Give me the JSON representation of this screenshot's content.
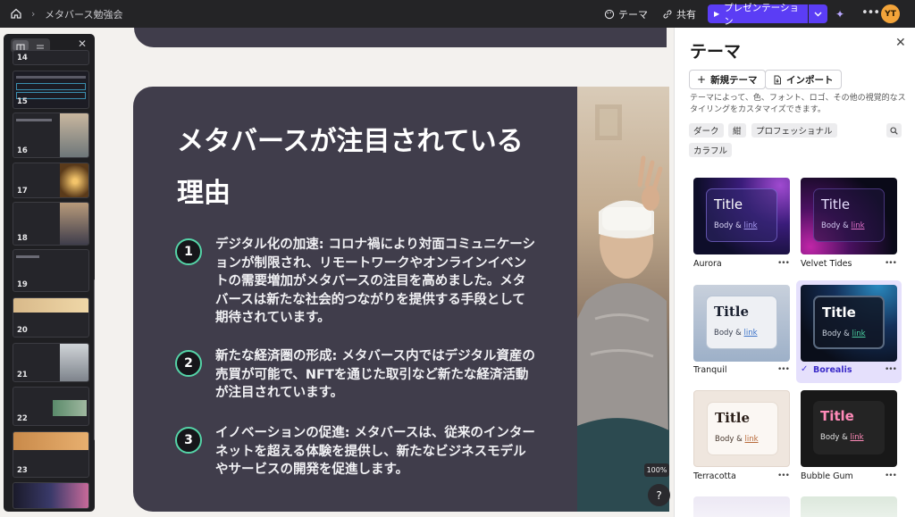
{
  "topbar": {
    "breadcrumb": "メタバース勉強会",
    "theme_label": "テーマ",
    "share_label": "共有",
    "present_label": "プレゼンテーション",
    "avatar_initials": "YT",
    "accent_color": "#5b3df5"
  },
  "slide_panel": {
    "thumbnails": [
      {
        "number": "14"
      },
      {
        "number": "15"
      },
      {
        "number": "16"
      },
      {
        "number": "17"
      },
      {
        "number": "18"
      },
      {
        "number": "19"
      },
      {
        "number": "20"
      },
      {
        "number": "21"
      },
      {
        "number": "22"
      },
      {
        "number": "23"
      }
    ]
  },
  "slide": {
    "title": "メタバースが注目されている理由",
    "bullets": [
      {
        "number": "1",
        "text": "デジタル化の加速: コロナ禍により対面コミュニケーションが制限され、リモートワークやオンラインイベントの需要増加がメタバースの注目を高めました。メタバースは新たな社会的つながりを提供する手段として期待されています。"
      },
      {
        "number": "2",
        "text": "新たな経済圏の形成: メタバース内ではデジタル資産の売買が可能で、NFTを通じた取引など新たな経済活動が注目されています。"
      },
      {
        "number": "3",
        "text": "イノベーションの促進: メタバースは、従来のインターネットを超える体験を提供し、新たなビジネスモデルやサービスの開発を促進します。"
      }
    ],
    "zoom": "100%",
    "help": "?"
  },
  "theme_panel": {
    "title": "テーマ",
    "new_theme_label": "新規テーマ",
    "import_label": "インポート",
    "description": "テーマによって、色、フォント、ロゴ、その他の視覚的なスタイリングをカスタマイズできます。",
    "tags": [
      "ダーク",
      "紺",
      "プロフェッショナル",
      "カラフル"
    ],
    "card_title": "Title",
    "card_body": "Body &",
    "card_link": "link",
    "themes": [
      {
        "name": "Aurora"
      },
      {
        "name": "Velvet Tides"
      },
      {
        "name": "Tranquil"
      },
      {
        "name": "Borealis",
        "selected": true
      },
      {
        "name": "Terracotta"
      },
      {
        "name": "Bubble Gum"
      }
    ]
  }
}
